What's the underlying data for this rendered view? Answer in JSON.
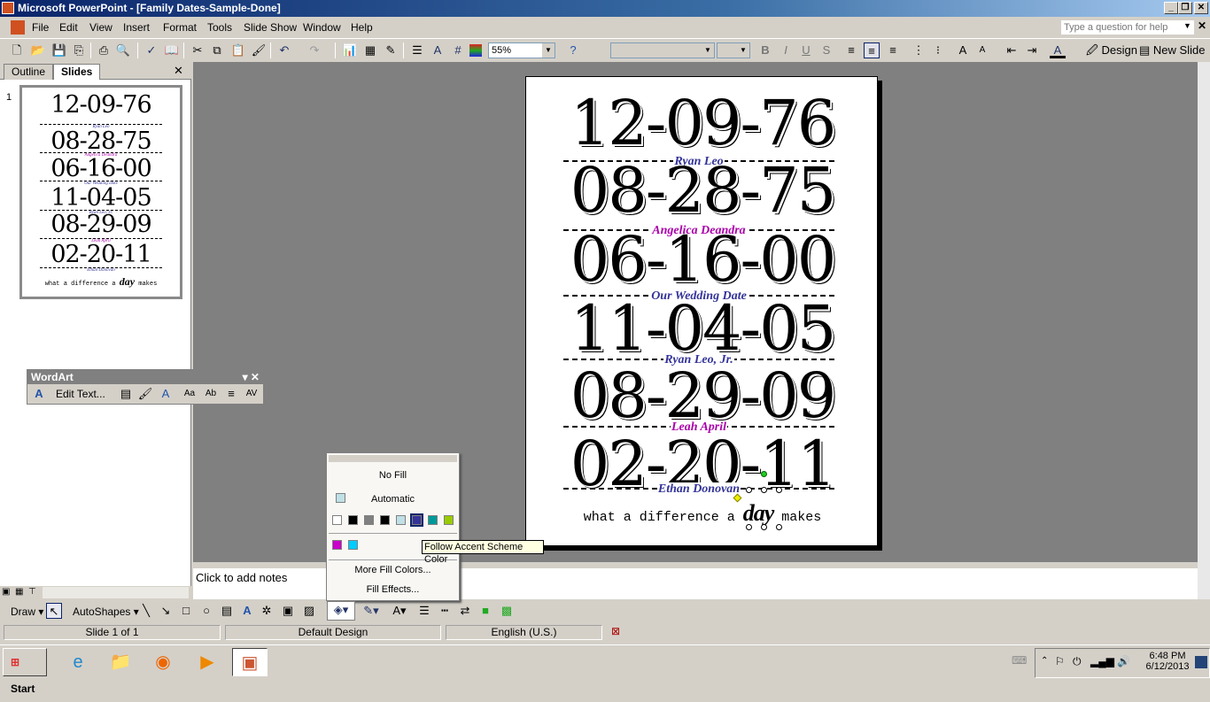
{
  "window": {
    "title": "Microsoft PowerPoint - [Family Dates-Sample-Done]"
  },
  "menu": [
    "File",
    "Edit",
    "View",
    "Insert",
    "Format",
    "Tools",
    "Slide Show",
    "Window",
    "Help"
  ],
  "help_placeholder": "Type a question for help",
  "toolbar": {
    "zoom": "55%",
    "design": "Design",
    "new_slide": "New Slide"
  },
  "panel": {
    "tabs": [
      "Outline",
      "Slides"
    ],
    "active_tab": "Slides",
    "slide_number": "1"
  },
  "wordart": {
    "title": "WordArt",
    "edit_text": "Edit Text..."
  },
  "slide": {
    "entries": [
      {
        "date": "12-09-76",
        "name": "Ryan Leo",
        "color": "#333399"
      },
      {
        "date": "08-28-75",
        "name": "Angelica Deandra",
        "color": "#aa00aa"
      },
      {
        "date": "06-16-00",
        "name": "Our Wedding Date",
        "color": "#333399"
      },
      {
        "date": "11-04-05",
        "name": "Ryan Leo, Jr.",
        "color": "#333399"
      },
      {
        "date": "08-29-09",
        "name": "Leah April",
        "color": "#aa00aa"
      },
      {
        "date": "02-20-11",
        "name": "Ethan Donovan",
        "color": "#333399"
      }
    ],
    "tagline_pre": "what a difference a",
    "tagline_word": "day",
    "tagline_post": "makes"
  },
  "notes_placeholder": "Click to add notes",
  "fill_menu": {
    "no_fill": "No Fill",
    "automatic": "Automatic",
    "automatic_color": "#bfe0e6",
    "scheme_colors": [
      "#ffffff",
      "#000000",
      "#808080",
      "#000000",
      "#bfe0e6",
      "#333399",
      "#009999",
      "#99cc00"
    ],
    "selected_index": 5,
    "recent_colors": [
      "#cc00cc",
      "#00ccff"
    ],
    "more_colors": "More Fill Colors...",
    "fill_effects": "Fill Effects...",
    "tooltip": "Follow Accent Scheme Color"
  },
  "drawbar": {
    "draw": "Draw",
    "autoshapes": "AutoShapes"
  },
  "status": {
    "slide": "Slide 1 of 1",
    "design": "Default Design",
    "language": "English (U.S.)"
  },
  "taskbar": {
    "start": "Start",
    "time": "6:48 PM",
    "date": "6/12/2013"
  }
}
